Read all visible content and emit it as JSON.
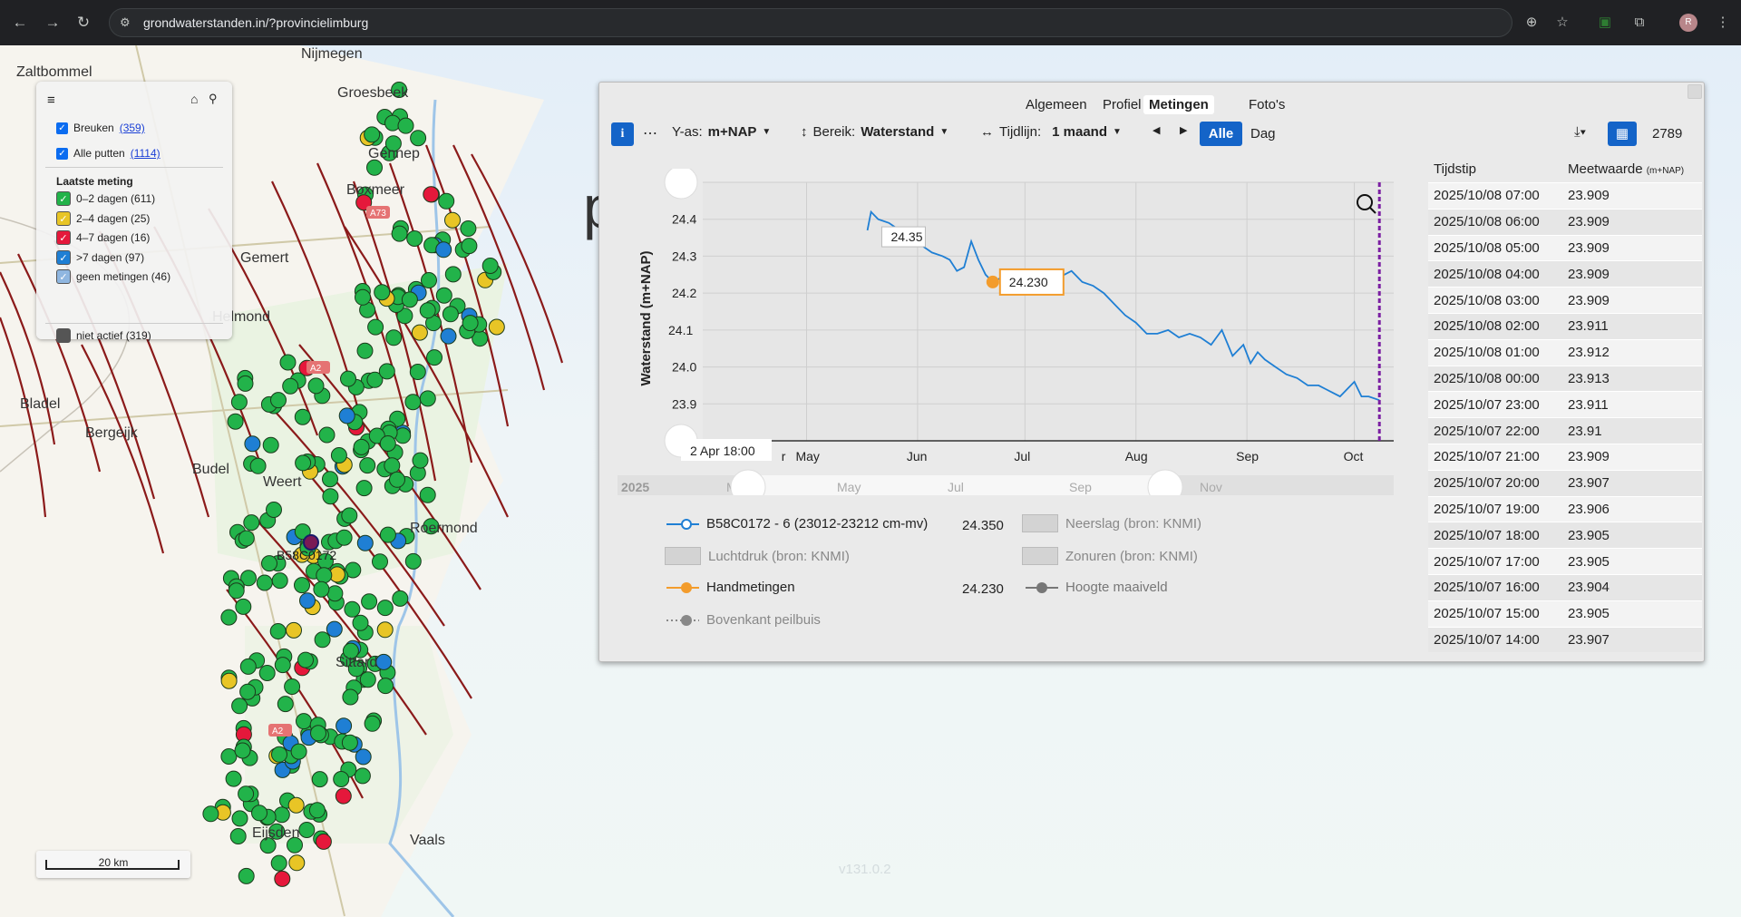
{
  "browser": {
    "url": "grondwaterstanden.in/?provincielimburg"
  },
  "map": {
    "place_labels": [
      "Zaltbommel",
      "Nijmegen",
      "Groesbeek",
      "Gennep",
      "Boxmeer",
      "Gemert",
      "Helmond",
      "Bladel",
      "Bergeijk",
      "Budel",
      "Roermond",
      "Sittard",
      "Eijsden",
      "Vaals",
      "Weert"
    ],
    "road_labels": [
      "A73",
      "A2",
      "A2"
    ],
    "selected_well": "B58C0172",
    "scale_label": "20 km",
    "version": "v131.0.2",
    "big_letter": "p"
  },
  "layers": {
    "faults_label": "Breuken",
    "faults_count": "(359)",
    "wells_label": "Alle putten",
    "wells_count": "(1114)",
    "legend_title": "Laatste meting",
    "items": [
      {
        "label": "0–2 dagen (611)",
        "color": "#22b34a"
      },
      {
        "label": "2–4 dagen (25)",
        "color": "#e8c526"
      },
      {
        "label": "4–7 dagen (16)",
        "color": "#e5183b"
      },
      {
        "label": ">7 dagen (97)",
        "color": "#1f7fd4"
      },
      {
        "label": "geen metingen (46)",
        "color": "#8fb6e0"
      }
    ],
    "inactive_label": "niet actief (319)"
  },
  "panel": {
    "tabs": [
      "Algemeen",
      "Profiel",
      "Metingen",
      "Foto's"
    ],
    "active_tab": "Metingen",
    "toolbar": {
      "yas_label": "Y-as:",
      "yas_value": "m+NAP",
      "bereik_label": "Bereik:",
      "bereik_value": "Waterstand",
      "tijdlijn_label": "Tijdlijn:",
      "tijdlijn_value": "1 maand",
      "alle": "Alle",
      "dag": "Dag",
      "count": "2789"
    },
    "table": {
      "col1": "Tijdstip",
      "col2": "Meetwaarde",
      "col2_unit": "(m+NAP)",
      "rows": [
        [
          "2025/10/08 07:00",
          "23.909"
        ],
        [
          "2025/10/08 06:00",
          "23.909"
        ],
        [
          "2025/10/08 05:00",
          "23.909"
        ],
        [
          "2025/10/08 04:00",
          "23.909"
        ],
        [
          "2025/10/08 03:00",
          "23.909"
        ],
        [
          "2025/10/08 02:00",
          "23.911"
        ],
        [
          "2025/10/08 01:00",
          "23.912"
        ],
        [
          "2025/10/08 00:00",
          "23.913"
        ],
        [
          "2025/10/07 23:00",
          "23.911"
        ],
        [
          "2025/10/07 22:00",
          "23.91"
        ],
        [
          "2025/10/07 21:00",
          "23.909"
        ],
        [
          "2025/10/07 20:00",
          "23.907"
        ],
        [
          "2025/10/07 19:00",
          "23.906"
        ],
        [
          "2025/10/07 18:00",
          "23.905"
        ],
        [
          "2025/10/07 17:00",
          "23.905"
        ],
        [
          "2025/10/07 16:00",
          "23.904"
        ],
        [
          "2025/10/07 15:00",
          "23.905"
        ],
        [
          "2025/10/07 14:00",
          "23.907"
        ]
      ]
    },
    "legend": {
      "series1": "B58C0172 - 6 (23012-23212 cm-mv)",
      "series1_value": "24.350",
      "neerslag": "Neerslag (bron: KNMI)",
      "luchtdruk": "Luchtdruk (bron: KNMI)",
      "zonuren": "Zonuren (bron: KNMI)",
      "handmetingen": "Handmetingen",
      "handmetingen_value": "24.230",
      "maaiveld": "Hoogte maaiveld",
      "bovenkant": "Bovenkant peilbuis"
    }
  },
  "chart_data": {
    "type": "line",
    "ylabel": "Waterstand (m+NAP)",
    "ylim": [
      23.8,
      24.5
    ],
    "yticks": [
      "23.8",
      "23.9",
      "24.0",
      "24.1",
      "24.2",
      "24.3",
      "24.4",
      "24.5"
    ],
    "xticks": [
      "r",
      "May",
      "Jun",
      "Jul",
      "Aug",
      "Sep",
      "Oct"
    ],
    "navigator_labels": [
      "2025",
      "M",
      "May",
      "Jul",
      "Sep",
      "Nov"
    ],
    "crosshair_x_label": "2 Apr 18:00",
    "crosshair_y_label": "24.1",
    "tooltip_series": "24.35",
    "tooltip_hand": "24.230",
    "colors": {
      "series": "#1f7fd4",
      "hand": "#f39c2c",
      "now_line": "#7b1fa2"
    },
    "series": [
      {
        "name": "B58C0172 - 6 (23012-23212 cm-mv)",
        "x": [
          "2025-05-18",
          "2025-05-19",
          "2025-05-21",
          "2025-05-24",
          "2025-05-27",
          "2025-05-30",
          "2025-06-02",
          "2025-06-05",
          "2025-06-08",
          "2025-06-10",
          "2025-06-12",
          "2025-06-14",
          "2025-06-16",
          "2025-06-18",
          "2025-06-20",
          "2025-06-22",
          "2025-06-24",
          "2025-06-26",
          "2025-06-28",
          "2025-06-30",
          "2025-07-02",
          "2025-07-04",
          "2025-07-06",
          "2025-07-08",
          "2025-07-10",
          "2025-07-12",
          "2025-07-14",
          "2025-07-17",
          "2025-07-20",
          "2025-07-23",
          "2025-07-26",
          "2025-07-29",
          "2025-08-01",
          "2025-08-04",
          "2025-08-07",
          "2025-08-10",
          "2025-08-13",
          "2025-08-16",
          "2025-08-19",
          "2025-08-22",
          "2025-08-25",
          "2025-08-28",
          "2025-08-31",
          "2025-09-02",
          "2025-09-04",
          "2025-09-06",
          "2025-09-09",
          "2025-09-12",
          "2025-09-15",
          "2025-09-18",
          "2025-09-21",
          "2025-09-23",
          "2025-09-25",
          "2025-09-27",
          "2025-09-29",
          "2025-10-01",
          "2025-10-03",
          "2025-10-05",
          "2025-10-08"
        ],
        "values": [
          24.37,
          24.42,
          24.4,
          24.39,
          24.37,
          24.35,
          24.33,
          24.31,
          24.3,
          24.29,
          24.26,
          24.27,
          24.34,
          24.29,
          24.25,
          24.23,
          24.24,
          24.2,
          24.22,
          24.2,
          24.21,
          24.23,
          24.24,
          24.22,
          24.24,
          24.25,
          24.26,
          24.23,
          24.22,
          24.2,
          24.17,
          24.14,
          24.12,
          24.09,
          24.09,
          24.1,
          24.08,
          24.09,
          24.08,
          24.06,
          24.1,
          24.03,
          24.06,
          24.01,
          24.04,
          24.02,
          24.0,
          23.98,
          23.97,
          23.95,
          23.95,
          23.94,
          23.93,
          23.92,
          23.94,
          23.96,
          23.92,
          23.92,
          23.91
        ]
      }
    ]
  }
}
